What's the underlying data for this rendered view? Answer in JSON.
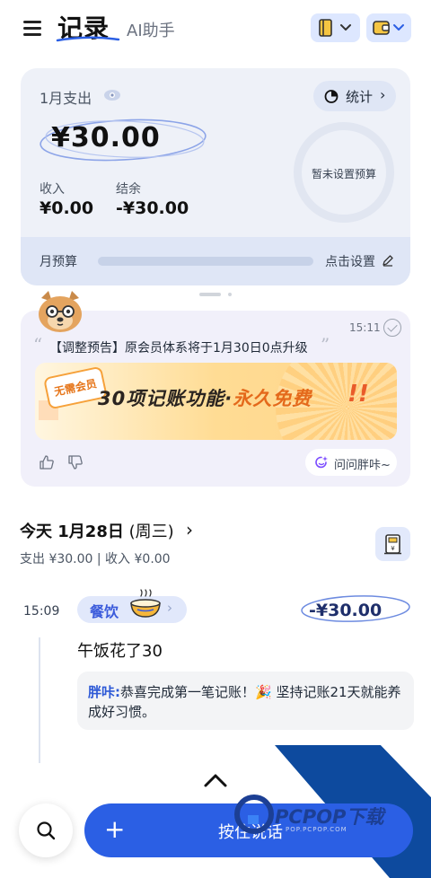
{
  "header": {
    "tab_active": "记录",
    "tab_inactive": "AI助手",
    "icons": [
      "menu-icon",
      "ledger-book-icon",
      "wallet-icon",
      "chevron-down-icon"
    ]
  },
  "summary": {
    "month_label": "1月支出",
    "expense_amount": "¥30.00",
    "stats_label": "统计",
    "income_label": "收入",
    "income_value": "¥0.00",
    "balance_label": "结余",
    "balance_value": "-¥30.00",
    "budget_ring_text": "暂未设置预算",
    "budget_label": "月预算",
    "budget_action": "点击设置"
  },
  "message": {
    "time": "15:11",
    "text": "【调整预告】原会员体系将于1月30日0点升级",
    "banner_tag": "无需会员",
    "banner_main_a": "30项记账功能·",
    "banner_main_b": "永久免费",
    "banner_excl": "!!",
    "ask_label": "问问胖咔~"
  },
  "day": {
    "title": "今天 1月28日",
    "weekday": "(周三)",
    "summary_line": "支出 ¥30.00 | 收入 ¥0.00"
  },
  "entry": {
    "time": "15:09",
    "category": "餐饮",
    "amount": "-¥30.00",
    "note": "午饭花了30",
    "reply_name": "胖咔:",
    "reply_text": "恭喜完成第一笔记账！🎉 坚持记账21天就能养成好习惯。"
  },
  "bottom": {
    "talk_label": "按住说话",
    "plus": "+"
  },
  "watermark": {
    "text": "PCPOP下载",
    "sub": "POP.PCPOP.COM"
  },
  "colors": {
    "accent": "#2b5fe4",
    "card_bg": "#eef1f8",
    "chip_bg": "#e1e8fb",
    "dark_blue": "#1c3f94"
  }
}
